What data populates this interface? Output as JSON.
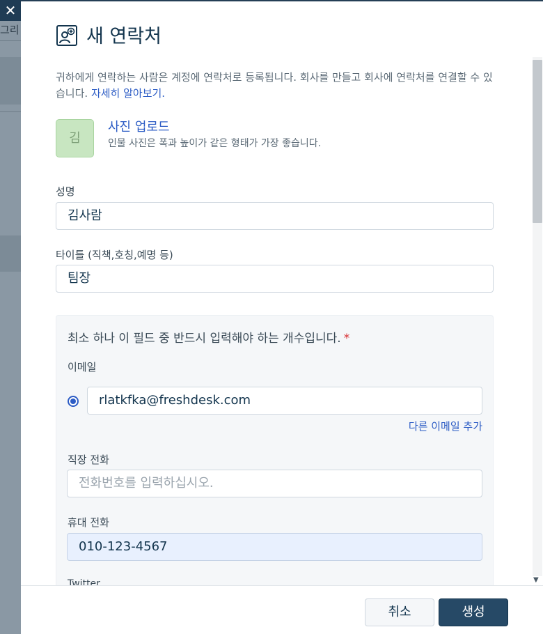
{
  "background": {
    "close_glyph": "✕",
    "partial_text": "그리"
  },
  "modal": {
    "title": "새 연락처",
    "title_icon": "add-contact-icon",
    "intro_text": "귀하에게 연락하는 사람은 계정에 연락처로 등록됩니다. 회사를 만들고 회사에 연락처를 연결할 수 있습니다. ",
    "intro_link": "자세히 알아보기.",
    "avatar_initial": "김",
    "upload_label": "사진 업로드",
    "upload_hint": "인물 사진은 폭과 높이가 같은 형태가 가장 좋습니다."
  },
  "fields": {
    "name_label": "성명",
    "name_value": "김사람",
    "title_label": "타이틀 (직책,호칭,예명 등)",
    "title_value": "팀장"
  },
  "required_group": {
    "heading": "최소 하나 이 필드 중 반드시 입력해야 하는 개수입니다.",
    "required_mark": "*",
    "email_label": "이메일",
    "email_value": "rlatkfka@freshdesk.com",
    "add_email_link": "다른 이메일 추가",
    "work_phone_label": "직장 전화",
    "work_phone_placeholder": "전화번호를 입력하십시오.",
    "mobile_label": "휴대 전화",
    "mobile_value": "010-123-4567",
    "next_label": "Twitter"
  },
  "footer": {
    "cancel_label": "취소",
    "create_label": "생성"
  },
  "colors": {
    "accent": "#2c5cc5",
    "primary_button": "#264966",
    "avatar_bg": "#c8e6c1"
  }
}
